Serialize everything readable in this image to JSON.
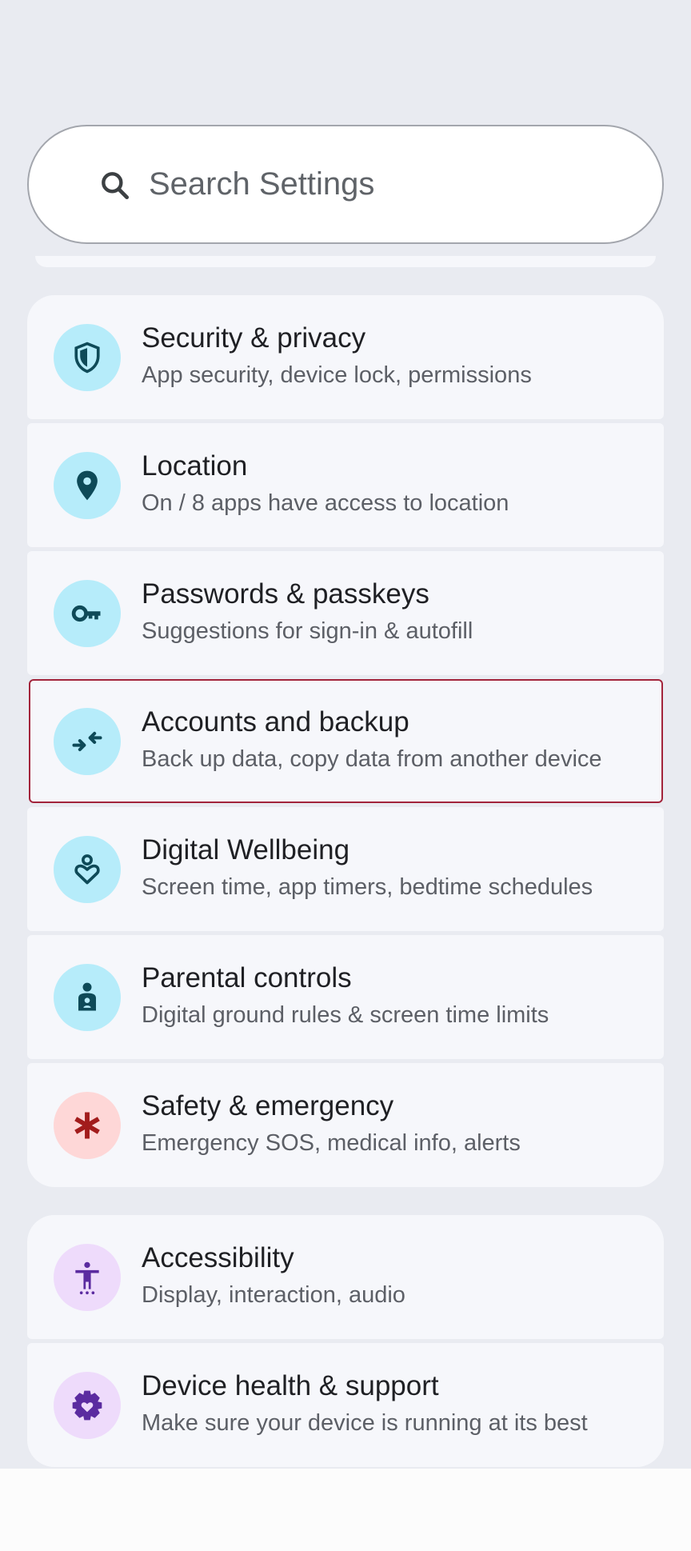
{
  "search": {
    "placeholder": "Search Settings",
    "icon": "search-icon"
  },
  "colors": {
    "background": "#e9ebf1",
    "card": "#f6f7fb",
    "cyan_icon_bg": "#b6ecfa",
    "cyan_icon_fg": "#0e4a58",
    "pink_icon_bg": "#fed7d7",
    "pink_icon_fg": "#a21c1c",
    "purple_icon_bg": "#eedbfb",
    "purple_icon_fg": "#5b2ba0",
    "highlight_border": "#a3243b"
  },
  "items": [
    {
      "title": "Security & privacy",
      "subtitle": "App security, device lock, permissions",
      "icon": "shield-icon"
    },
    {
      "title": "Location",
      "subtitle": "On / 8 apps have access to location",
      "icon": "location-pin-icon"
    },
    {
      "title": "Passwords & passkeys",
      "subtitle": "Suggestions for sign-in & autofill",
      "icon": "key-icon"
    },
    {
      "title": "Accounts and backup",
      "subtitle": "Back up data, copy data from another device",
      "icon": "sync-arrows-icon"
    },
    {
      "title": "Digital Wellbeing",
      "subtitle": "Screen time, app timers, bedtime schedules",
      "icon": "wellbeing-heart-icon"
    },
    {
      "title": "Parental controls",
      "subtitle": "Digital ground rules & screen time limits",
      "icon": "parental-person-icon"
    },
    {
      "title": "Safety & emergency",
      "subtitle": "Emergency SOS, medical info, alerts",
      "icon": "asterisk-icon"
    },
    {
      "title": "Accessibility",
      "subtitle": "Display, interaction, audio",
      "icon": "accessibility-icon"
    },
    {
      "title": "Device health & support",
      "subtitle": "Make sure your device is running at its best",
      "icon": "gear-heart-icon"
    }
  ]
}
